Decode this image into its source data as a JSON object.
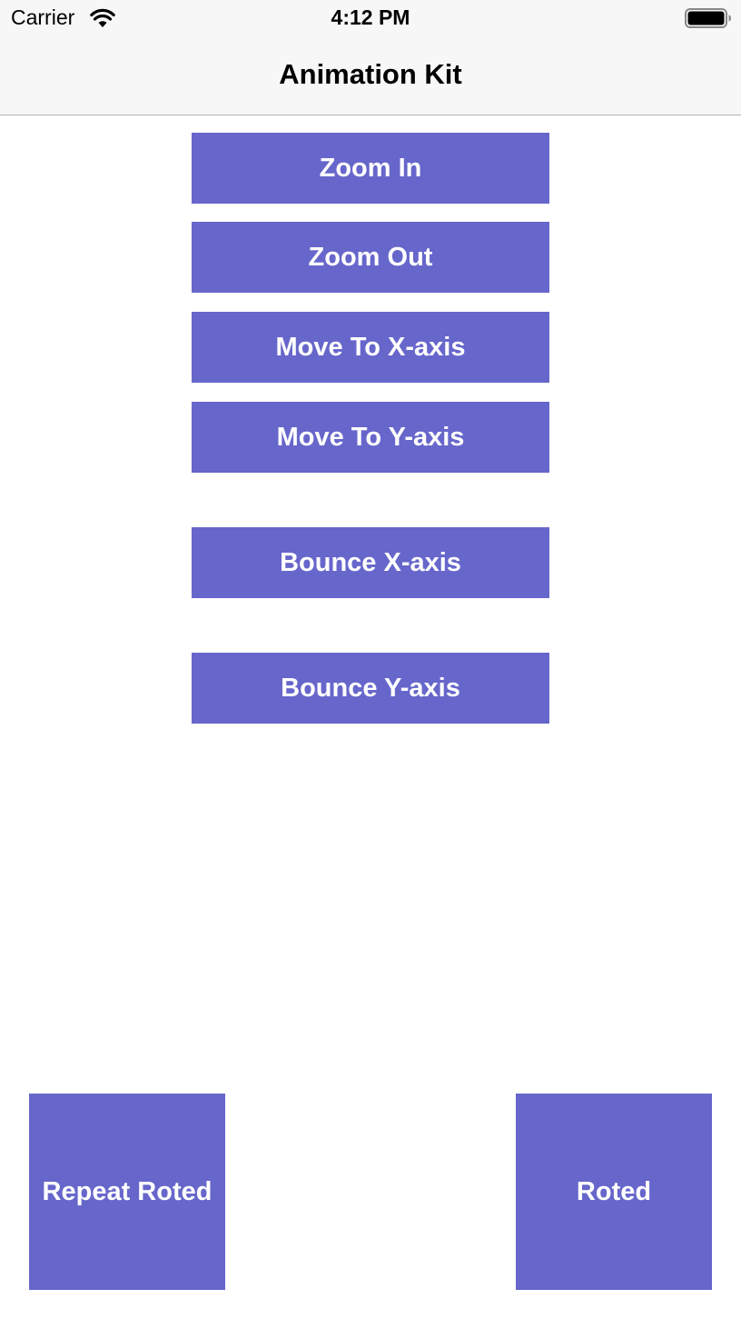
{
  "status_bar": {
    "carrier": "Carrier",
    "time": "4:12 PM",
    "wifi_icon": "wifi-icon",
    "battery_icon": "battery-icon"
  },
  "nav": {
    "title": "Animation Kit"
  },
  "buttons": {
    "zoom_in": "Zoom In",
    "zoom_out": "Zoom Out",
    "move_x": "Move To X-axis",
    "move_y": "Move To Y-axis",
    "bounce_x": "Bounce X-axis",
    "bounce_y": "Bounce Y-axis",
    "repeat_roted": "Repeat Roted",
    "roted": "Roted"
  },
  "colors": {
    "button_bg": "#6766cb",
    "button_text": "#ffffff",
    "bar_bg": "#f7f7f7"
  }
}
